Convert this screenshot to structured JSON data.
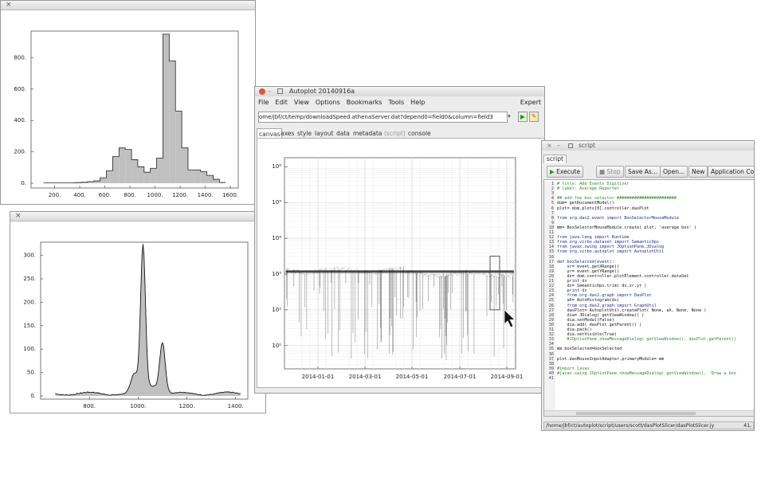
{
  "hist1": {
    "yticks": [
      "0.",
      "200.",
      "400.",
      "600.",
      "800."
    ],
    "xticks": [
      "200.",
      "400.",
      "600.",
      "800.",
      "1000.",
      "1200.",
      "1400.",
      "1600."
    ],
    "values": [
      2,
      2,
      2,
      2,
      2,
      4,
      6,
      10,
      15,
      35,
      80,
      170,
      225,
      215,
      150,
      105,
      70,
      95,
      160,
      950,
      780,
      460,
      225,
      85,
      85,
      75,
      50,
      25,
      5
    ]
  },
  "hist2": {
    "yticks": [
      "0.",
      "50.",
      "100.",
      "150.",
      "200.",
      "250.",
      "300."
    ],
    "xticks": [
      "800.",
      "1000.",
      "1200.",
      "1400."
    ]
  },
  "autoplot": {
    "title": "Autoplot 20140916a",
    "menu": [
      "File",
      "Edit",
      "View",
      "Options",
      "Bookmarks",
      "Tools",
      "Help"
    ],
    "expert": "Expert",
    "url": "ome/jbf/ct/temp/downloadSpeed.athenaServer.dat?depend0=field0&column=field3",
    "tabs": [
      "canvas",
      "axes",
      "style",
      "layout",
      "data",
      "metadata",
      "(script)",
      "console"
    ],
    "yticks": [
      "10⁶",
      "10⁵",
      "10⁴",
      "10³",
      "10²",
      "10¹"
    ],
    "xticks": [
      "2014-01-01",
      "2014-03-01",
      "2014-05-01",
      "2014-07-01",
      "2014-09-01"
    ]
  },
  "script": {
    "title": "script",
    "tab": "script",
    "buttons": {
      "execute": "Execute",
      "stop": "Stop",
      "saveas": "Save As...",
      "open": "Open...",
      "new": "New",
      "context": "Application Co"
    },
    "lines": [
      "# title: Add Events Digitizer",
      "# label: Average Reporter",
      "",
      "## add the box selector ########################",
      "dom= getDocumentModel()",
      "plot= dom.plots[0].controller.dasPlot",
      "",
      "from org.das2.event import BoxSelectorMouseModule",
      "",
      "mm= BoxSelectorMouseModule.create( plot, 'average box' )",
      "",
      "from java.lang import Runtime",
      "from org.virbo.dataset import SemanticOps",
      "from javax.swing import JOptionPane,JDialog",
      "from org.virbo.autoplot import AutoplotUtil",
      "",
      "def boxSelected(event):",
      "    xr= event.getXRange()",
      "    yr= event.getYRange()",
      "    ds= dom.controller.plotElement.controller.dataSet",
      "    print ds",
      "    ds= SemanticOps.trim( ds,xr,yr )",
      "    print ds",
      "    from org.das2.graph import DasPlot",
      "    ah= AutoHistogram(ds)",
      "    from org.das2.graph import GraphUtil",
      "    dasPlot= AutoplotUtil.createPlot( None, ah, None, None )",
      "    dia= JDialog( getViewWindow() )",
      "    dia.setModal(False)",
      "    dia.add( dasPlot.getParent() )",
      "    dia.pack()",
      "    dia.setVisible(True)",
      "    #JOptionPane.showMessageDialog( getViewWindow(), dasPlot.getParent()",
      "",
      "mm.boxSelected=boxSelected",
      "",
      "plot.dasMouseInputAdapter.primaryModule= mm",
      "",
      "#import javax",
      "#javax.swing.JOptionPane.showMessageDialog( getViewWindow(), 'Draw a box",
      ""
    ],
    "path": "/home/jbf/ct/autoplot/script/users/scott/dasPlotSlicer/dasPlotSlicer.jy",
    "cursor": "41,"
  }
}
